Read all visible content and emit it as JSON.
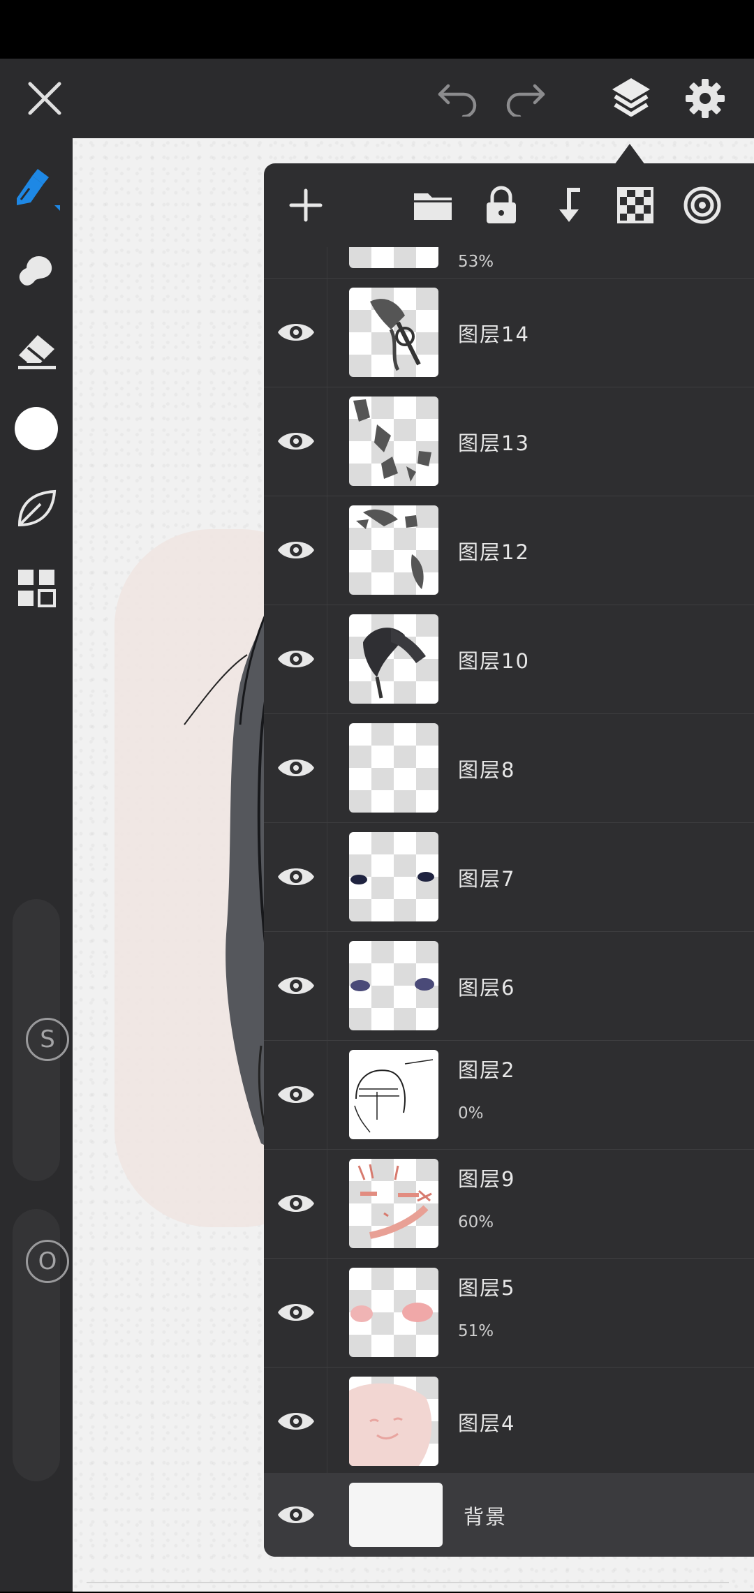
{
  "app": {
    "accent": "#1e88e5",
    "panel_bg": "#2e2e30"
  },
  "top_bar": {
    "icons": [
      "close-icon",
      "undo-icon",
      "redo-icon",
      "layers-icon",
      "gear-icon"
    ]
  },
  "left_toolbar": {
    "tools": [
      "brush-icon",
      "smudge-icon",
      "eraser-icon",
      "color-swatch",
      "leaf-icon",
      "grid-icon"
    ],
    "size_slider_label": "S",
    "opacity_slider_label": "O"
  },
  "layers_panel": {
    "toolbar_icons": [
      "add-icon",
      "folder-icon",
      "lock-icon",
      "merge-down-icon",
      "checker-icon",
      "target-icon"
    ],
    "partial_top_opacity": "53%",
    "layers": [
      {
        "name": "图层14",
        "opacity": ""
      },
      {
        "name": "图层13",
        "opacity": ""
      },
      {
        "name": "图层12",
        "opacity": ""
      },
      {
        "name": "图层10",
        "opacity": ""
      },
      {
        "name": "图层8",
        "opacity": ""
      },
      {
        "name": "图层7",
        "opacity": ""
      },
      {
        "name": "图层6",
        "opacity": ""
      },
      {
        "name": "图层2",
        "opacity": "0%"
      },
      {
        "name": "图层9",
        "opacity": "60%"
      },
      {
        "name": "图层5",
        "opacity": "51%"
      },
      {
        "name": "图层4",
        "opacity": ""
      }
    ],
    "background_layer": {
      "name": "背景"
    }
  }
}
